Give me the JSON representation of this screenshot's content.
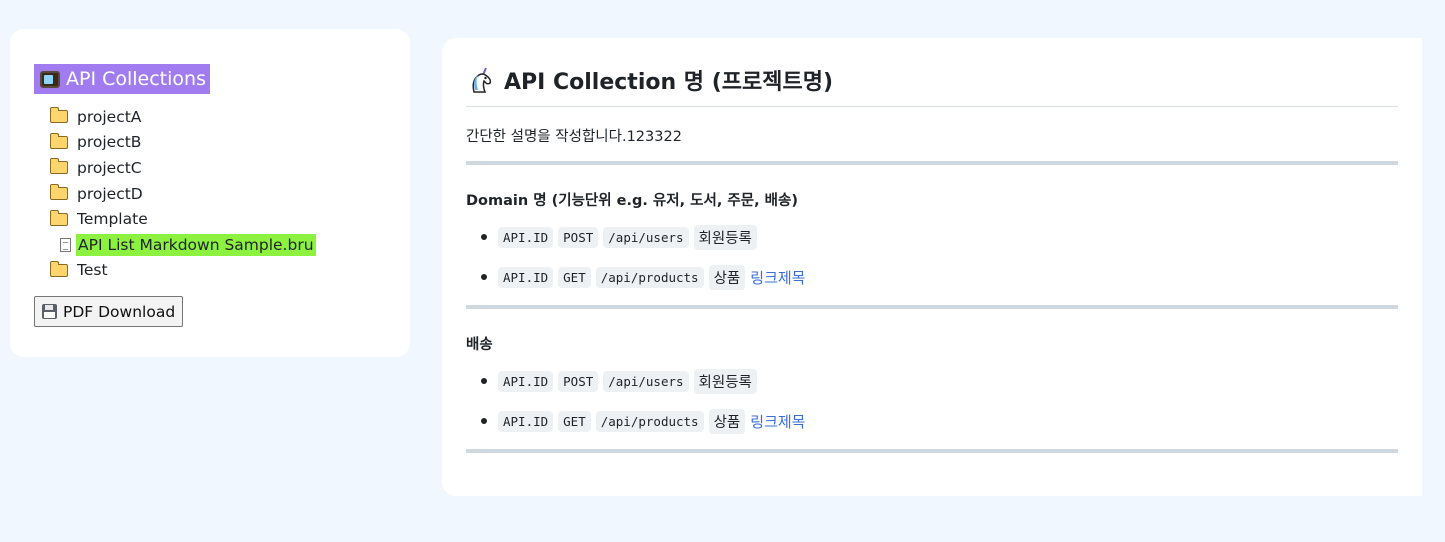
{
  "sidebar": {
    "title": "API Collections",
    "items": [
      {
        "type": "folder",
        "label": "projectA"
      },
      {
        "type": "folder",
        "label": "projectB"
      },
      {
        "type": "folder",
        "label": "projectC"
      },
      {
        "type": "folder",
        "label": "projectD"
      },
      {
        "type": "folder",
        "label": "Template"
      },
      {
        "type": "file",
        "label": "API List Markdown Sample.bru"
      },
      {
        "type": "folder",
        "label": "Test"
      }
    ],
    "pdf_button": "PDF Download"
  },
  "main": {
    "title": "API Collection 명 (프로젝트명)",
    "description": "간단한 설명을 작성합니다.123322",
    "sections": [
      {
        "title": "Domain 명 (기능단위 e.g. 유저, 도서, 주문, 배송)",
        "apis": [
          {
            "id": "API.ID",
            "method": "POST",
            "path": "/api/users",
            "name": "회원등록",
            "link": ""
          },
          {
            "id": "API.ID",
            "method": "GET",
            "path": "/api/products",
            "name": "상품",
            "link": "링크제목"
          }
        ]
      },
      {
        "title": "배송",
        "apis": [
          {
            "id": "API.ID",
            "method": "POST",
            "path": "/api/users",
            "name": "회원등록",
            "link": ""
          },
          {
            "id": "API.ID",
            "method": "GET",
            "path": "/api/products",
            "name": "상품",
            "link": "링크제목"
          }
        ]
      }
    ]
  },
  "colors": {
    "page_bg": "#f1f7ff",
    "sidebar_title_bg": "#a07cf0",
    "selected_file_bg": "#8cf23f",
    "link": "#3a6fd6"
  }
}
